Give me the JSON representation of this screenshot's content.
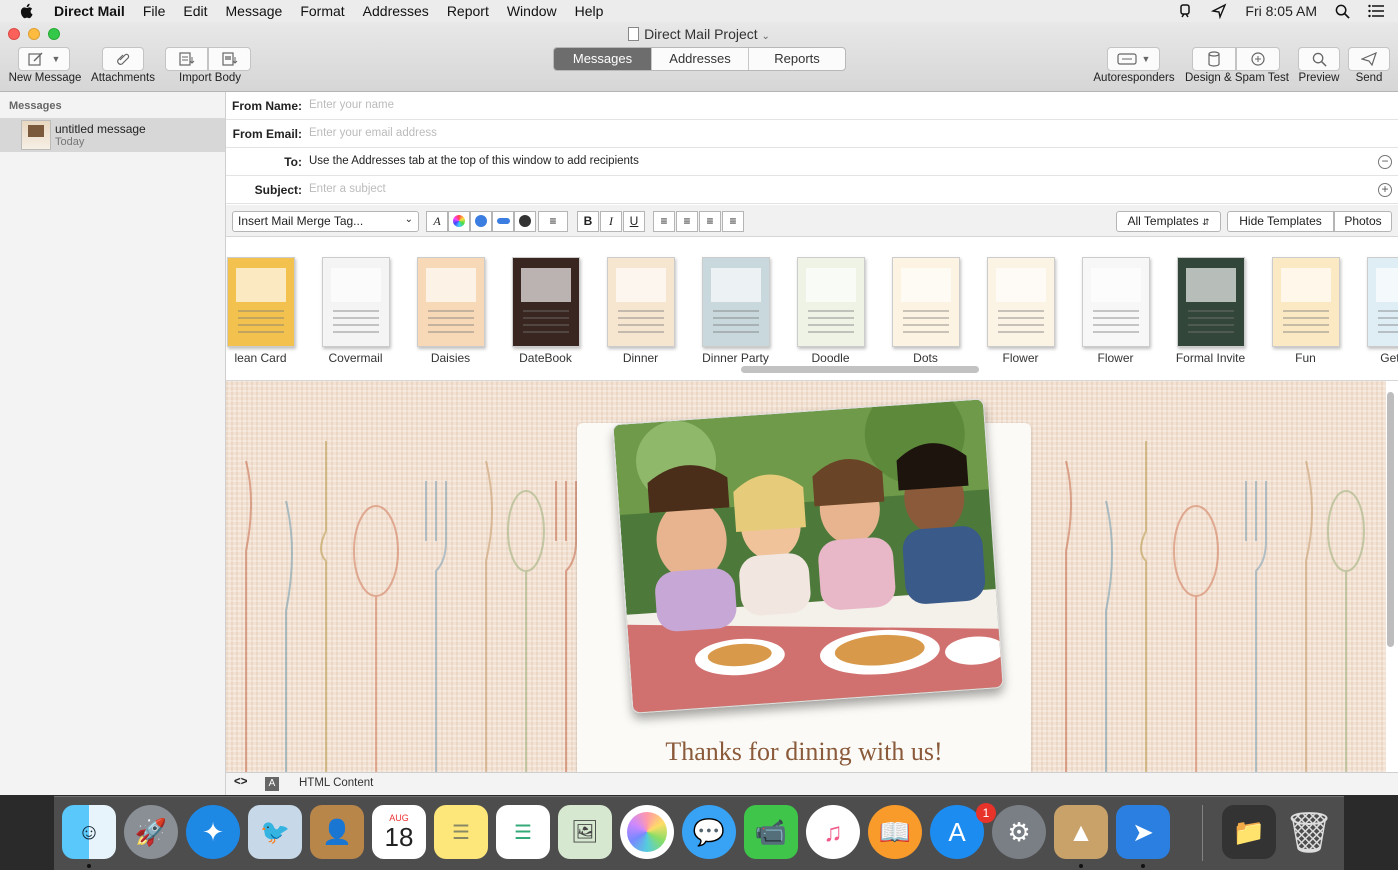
{
  "menubar": {
    "app_name": "Direct Mail",
    "items": [
      "File",
      "Edit",
      "Message",
      "Format",
      "Addresses",
      "Report",
      "Window",
      "Help"
    ],
    "clock": "Fri 8:05 AM"
  },
  "window": {
    "title": "Direct Mail Project",
    "toolbar": {
      "new_message": "New Message",
      "attachments": "Attachments",
      "import_body": "Import Body",
      "autoresponders": "Autoresponders",
      "design_spam_test": "Design & Spam Test",
      "preview": "Preview",
      "send": "Send"
    },
    "tabs": [
      {
        "label": "Messages",
        "active": true
      },
      {
        "label": "Addresses",
        "active": false
      },
      {
        "label": "Reports",
        "active": false
      }
    ]
  },
  "sidebar": {
    "header": "Messages",
    "items": [
      {
        "title": "untitled message",
        "subtitle": "Today"
      }
    ]
  },
  "fields": {
    "from_name": {
      "label": "From Name:",
      "placeholder": "Enter your name"
    },
    "from_email": {
      "label": "From Email:",
      "placeholder": "Enter your email address"
    },
    "to": {
      "label": "To:",
      "value": "Use the Addresses tab at the top of this window to add recipients"
    },
    "subject": {
      "label": "Subject:",
      "placeholder": "Enter a subject"
    }
  },
  "format_bar": {
    "merge_tag": "Insert Mail Merge Tag...",
    "bold": "B",
    "italic": "I",
    "underline": "U",
    "font_a": "A",
    "all_templates": "All Templates",
    "hide_templates": "Hide Templates",
    "photos": "Photos"
  },
  "templates": [
    {
      "name": "lean Card",
      "color": "#f2c14e"
    },
    {
      "name": "Covermail",
      "color": "#f4f4f4"
    },
    {
      "name": "Daisies",
      "color": "#f7d9b8"
    },
    {
      "name": "DateBook",
      "color": "#3a2620"
    },
    {
      "name": "Dinner",
      "color": "#f6e5cf"
    },
    {
      "name": "Dinner Party",
      "color": "#c8d8dc"
    },
    {
      "name": "Doodle",
      "color": "#eef3e6"
    },
    {
      "name": "Dots",
      "color": "#fdf3e2"
    },
    {
      "name": "Flower",
      "color": "#fbf4e4"
    },
    {
      "name": "Flower",
      "color": "#f7f7f7"
    },
    {
      "name": "Formal Invite",
      "color": "#33463a"
    },
    {
      "name": "Fun",
      "color": "#fbe9c3"
    },
    {
      "name": "Get We",
      "color": "#dfeef5"
    }
  ],
  "preview": {
    "headline": "Thanks for dining with us!"
  },
  "bottom_bar": {
    "mode": "HTML Content"
  },
  "dock": {
    "calendar_month": "AUG",
    "calendar_day": "18",
    "appstore_badge": "1"
  }
}
